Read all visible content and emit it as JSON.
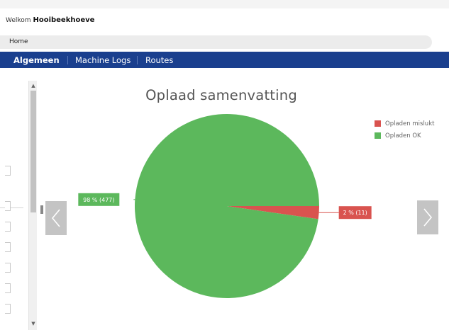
{
  "header": {
    "welcome_prefix": "Welkom",
    "user_name": "Hooibeekhoeve"
  },
  "breadcrumb": {
    "home": "Home"
  },
  "tabs": [
    {
      "label": "Algemeen",
      "active": true
    },
    {
      "label": "Machine Logs",
      "active": false
    },
    {
      "label": "Routes",
      "active": false
    }
  ],
  "nav": {
    "prev_icon": "chevron-left-icon",
    "next_icon": "chevron-right-icon"
  },
  "colors": {
    "tabbar": "#1a3f8e",
    "ok": "#5cb85c",
    "fail": "#d9534f",
    "nav_button": "#c4c4c4"
  },
  "chart_data": {
    "type": "pie",
    "title": "Oplaad samenvatting",
    "legend_position": "top-right",
    "slices": [
      {
        "name": "Opladen mislukt",
        "percent": 2,
        "count": 11,
        "label": "2 % (11)",
        "color": "#d9534f"
      },
      {
        "name": "Opladen OK",
        "percent": 98,
        "count": 477,
        "label": "98 % (477)",
        "color": "#5cb85c"
      }
    ]
  }
}
